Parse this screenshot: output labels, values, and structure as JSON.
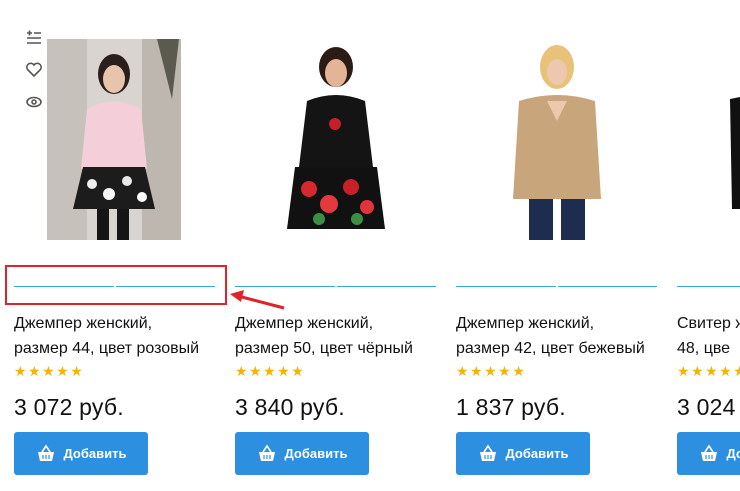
{
  "products": [
    {
      "title_line1": "Джемпер женский,",
      "title_line2": "размер 44, цвет розовый",
      "stars": "★★★★★",
      "price": "3 072 руб.",
      "button": "Добавить"
    },
    {
      "title_line1": "Джемпер женский,",
      "title_line2": "размер 50, цвет чёрный",
      "stars": "★★★★★",
      "price": "3 840 руб.",
      "button": "Добавить"
    },
    {
      "title_line1": "Джемпер женский,",
      "title_line2": "размер 42, цвет бежевый",
      "stars": "★★★★★",
      "price": "1 837 руб.",
      "button": "Добавить"
    },
    {
      "title_line1": "Свитер ж",
      "title_line2": "48, цве",
      "stars": "★★★★★",
      "price": "3 024",
      "button": "Добавить"
    }
  ],
  "side_tools": [
    "compare-icon",
    "heart-icon",
    "eye-icon"
  ],
  "colors": {
    "accent": "#2c8fe0",
    "star": "#f5b400",
    "slider": "#37a6d8",
    "highlight": "#e0232a"
  }
}
